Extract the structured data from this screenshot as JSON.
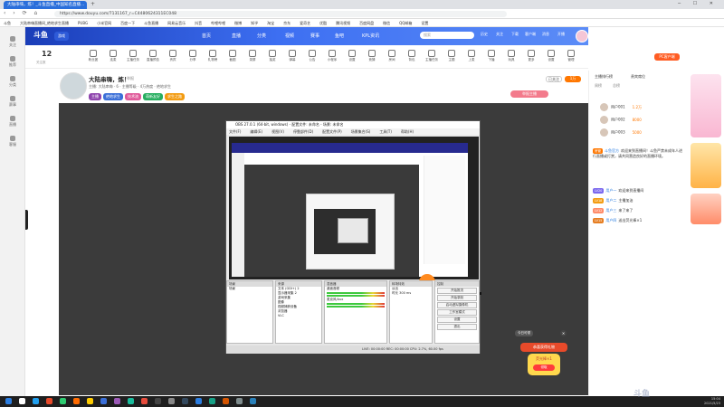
{
  "browser": {
    "tab_title": "大陆串嗨，炼！_斗鱼直播_中国知名直播...",
    "url": "https://www.douyu.com/7131167_r=C4480624311EC048",
    "bookmarks": [
      "斗鱼",
      "大陆串嗨直播间_绝地求生直播",
      "PUBG",
      "小米官网",
      "百度一下",
      "斗鱼直播",
      "网易云音乐",
      "抖音",
      "哔哩哔哩",
      "微博",
      "知乎",
      "淘宝",
      "京东",
      "爱奇艺",
      "优酷",
      "腾讯视频",
      "百度网盘",
      "微信",
      "QQ邮箱",
      "设置"
    ]
  },
  "left_sidebar": [
    {
      "label": "关注"
    },
    {
      "label": "推荐"
    },
    {
      "label": "分类"
    },
    {
      "label": "赛事"
    },
    {
      "label": "直播"
    },
    {
      "label": "客服"
    }
  ],
  "header": {
    "logo": "斗鱼",
    "game": "游戏",
    "nav": [
      "首页",
      "直播",
      "分类",
      "视频",
      "赛事",
      "鱼吧",
      "KPL资讯"
    ],
    "search_placeholder": "搜索",
    "icons": [
      "历史",
      "关注",
      "下载",
      "客户端",
      "消息",
      "开播"
    ]
  },
  "icon_row": {
    "count": "12",
    "count_label": "关注数",
    "items": [
      "粉丝团",
      "连麦",
      "主播任务",
      "直播预告",
      "贵宾",
      "分享",
      "礼物榜",
      "截图",
      "录屏",
      "抽奖",
      "弹幕",
      "公告",
      "小程序",
      "设置",
      "竞猜",
      "房间",
      "背包",
      "主播任务",
      "主题",
      "上麦",
      "下播",
      "玩具",
      "更多",
      "设置",
      "管理"
    ],
    "pc_button": "PC客户端"
  },
  "streamer": {
    "title": "大陆串嗨，炼！",
    "meta": "举报",
    "line2": "主播: 大陆串嗨  ·  6  ·  主播等级  ·  4万热度  ·  绝地求生",
    "tags": [
      "主播",
      "绝地求生",
      "技术流",
      "萌新友好",
      "求生之路"
    ],
    "follow_label": "已关注",
    "follow_count": "1万",
    "report_label": "举报主播"
  },
  "obs": {
    "title": "OBS 27.0.1 (64-bit, windows) - 配置文件: 未命名 - 场景: 未命名",
    "menu": [
      "文件(F)",
      "编辑(E)",
      "视图(V)",
      "停靠部件(D)",
      "配置文件(P)",
      "场景集合(S)",
      "工具(T)",
      "帮助(H)"
    ],
    "panels": {
      "scenes": {
        "title": "场景",
        "items": [
          "场景"
        ]
      },
      "sources": {
        "title": "来源",
        "items": [
          "文本 (GDI+) 2",
          "显示器采集 2",
          "游戏采集",
          "图像",
          "视频捕获设备",
          "浏览器",
          "VLC"
        ]
      },
      "mixer": {
        "title": "混音器",
        "items": [
          "桌面音频",
          "麦克风/Aux"
        ]
      },
      "transitions": {
        "title": "转场特效",
        "items": [
          "淡出",
          "时长 300 ms"
        ]
      },
      "controls": {
        "title": "控制",
        "items": [
          "开始推流",
          "开始录制",
          "启动虚拟摄像机",
          "工作室模式",
          "设置",
          "退出"
        ]
      }
    },
    "status": "LIVE: 00:00:00  REC: 00:00:00  CPU: 2.7%, 60.00 fps"
  },
  "gift_popup": {
    "tip": "今日可领",
    "banner": "恭喜获得礼物",
    "text": "荧光棒×1",
    "button": "领取"
  },
  "right_panel": {
    "tabs": [
      "主播排行榜",
      "贵宾席位"
    ],
    "rank_tabs": [
      "周榜",
      "总榜"
    ],
    "ranks": [
      {
        "name": "用户001",
        "score": "1.2万"
      },
      {
        "name": "用户002",
        "score": "8000"
      },
      {
        "name": "用户003",
        "score": "5000"
      }
    ],
    "chat": [
      {
        "badge": "房管",
        "user": "斗鱼官方",
        "text": "欢迎来到直播间！斗鱼严禁未成年人进行直播或打赏，请共同营造良好的直播环境。"
      },
      {
        "badge": "LV20",
        "user": "用户一",
        "text": "欢迎来到直播间"
      },
      {
        "badge": "LV18",
        "user": "用户二",
        "text": "主播加油"
      },
      {
        "badge": "LV12",
        "user": "用户三",
        "text": "来了来了"
      },
      {
        "badge": "LV15",
        "user": "用户四",
        "text": "送出荧光棒×1"
      }
    ]
  },
  "taskbar": {
    "time": "15:04",
    "date": "2021/5/23"
  },
  "watermark": "斗鱼"
}
